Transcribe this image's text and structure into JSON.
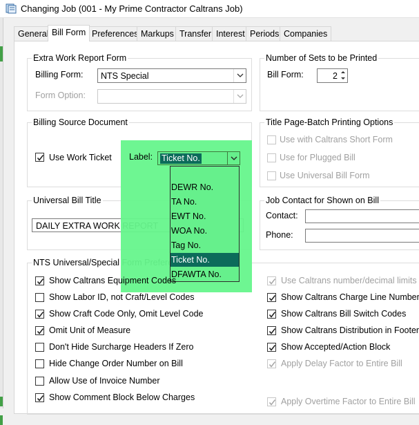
{
  "window": {
    "title": "Changing Job  (001 - My Prime Contractor Caltrans Job)"
  },
  "tabs": [
    "General",
    "Bill Form",
    "Preferences",
    "Markups",
    "Transfer",
    "Interest",
    "Periods",
    "Companies"
  ],
  "extra_work": {
    "title": "Extra Work Report Form",
    "billing_form_label": "Billing Form:",
    "billing_form_value": "NTS Special",
    "form_option_label": "Form Option:",
    "form_option_value": ""
  },
  "sets": {
    "title": "Number of Sets to be Printed",
    "bill_form_label": "Bill Form:",
    "bill_form_value": "2"
  },
  "billing_source": {
    "title": "Billing Source Document",
    "use_work_ticket_label": "Use Work Ticket",
    "use_work_ticket_checked": true,
    "label_label": "Label:",
    "label_value": "Ticket No."
  },
  "dropdown": {
    "items": [
      "DEWR No.",
      "TA No.",
      "EWT No.",
      "WOA No.",
      "Tag No.",
      "Ticket No.",
      "DFAWTA No."
    ],
    "selected": "Ticket No.",
    "highlight_color": "#66f08c"
  },
  "title_page": {
    "title": "Title Page-Batch Printing Options",
    "options": [
      {
        "label": "Use with Caltrans Short Form",
        "checked": false,
        "enabled": false
      },
      {
        "label": "Use for Plugged Bill",
        "checked": false,
        "enabled": false
      },
      {
        "label": "Use Universal Bill Form",
        "checked": false,
        "enabled": false
      }
    ]
  },
  "universal_title": {
    "title": "Universal Bill Title",
    "value": "DAILY EXTRA WORK REPORT"
  },
  "job_contact": {
    "title": "Job Contact for Shown on Bill",
    "contact_label": "Contact:",
    "contact_value": "",
    "phone_label": "Phone:",
    "phone_value": ""
  },
  "nts_prefs": {
    "title": "NTS Universal/Special Form Preferences",
    "left": [
      {
        "label": "Show Caltrans Equipment Codes",
        "checked": true,
        "enabled": true
      },
      {
        "label": "Show Labor ID, not Craft/Level Codes",
        "checked": false,
        "enabled": true
      },
      {
        "label": "Show Craft Code Only, Omit Level Code",
        "checked": true,
        "enabled": true
      },
      {
        "label": "Omit Unit of Measure",
        "checked": true,
        "enabled": true
      },
      {
        "label": "Don't Hide Surcharge Headers If Zero",
        "checked": false,
        "enabled": true
      },
      {
        "label": "Hide Change Order Number on Bill",
        "checked": false,
        "enabled": true
      },
      {
        "label": "Allow Use of Invoice Number",
        "checked": false,
        "enabled": true
      },
      {
        "label": "Show Comment Block Below Charges",
        "checked": true,
        "enabled": true
      }
    ],
    "right": [
      {
        "label": "Use Caltrans number/decimal limits",
        "checked": true,
        "enabled": false
      },
      {
        "label": "Show Caltrans Charge Line Numbers",
        "checked": true,
        "enabled": true
      },
      {
        "label": "Show Caltrans Bill Switch Codes",
        "checked": true,
        "enabled": true
      },
      {
        "label": "Show Caltrans Distribution in Footer",
        "checked": true,
        "enabled": true
      },
      {
        "label": "Show Accepted/Action Block",
        "checked": true,
        "enabled": true
      },
      {
        "label": "Apply Delay Factor to Entire Bill",
        "checked": true,
        "enabled": false
      },
      {
        "label": "Apply Overtime Factor to Entire Bill",
        "checked": true,
        "enabled": false
      }
    ]
  }
}
